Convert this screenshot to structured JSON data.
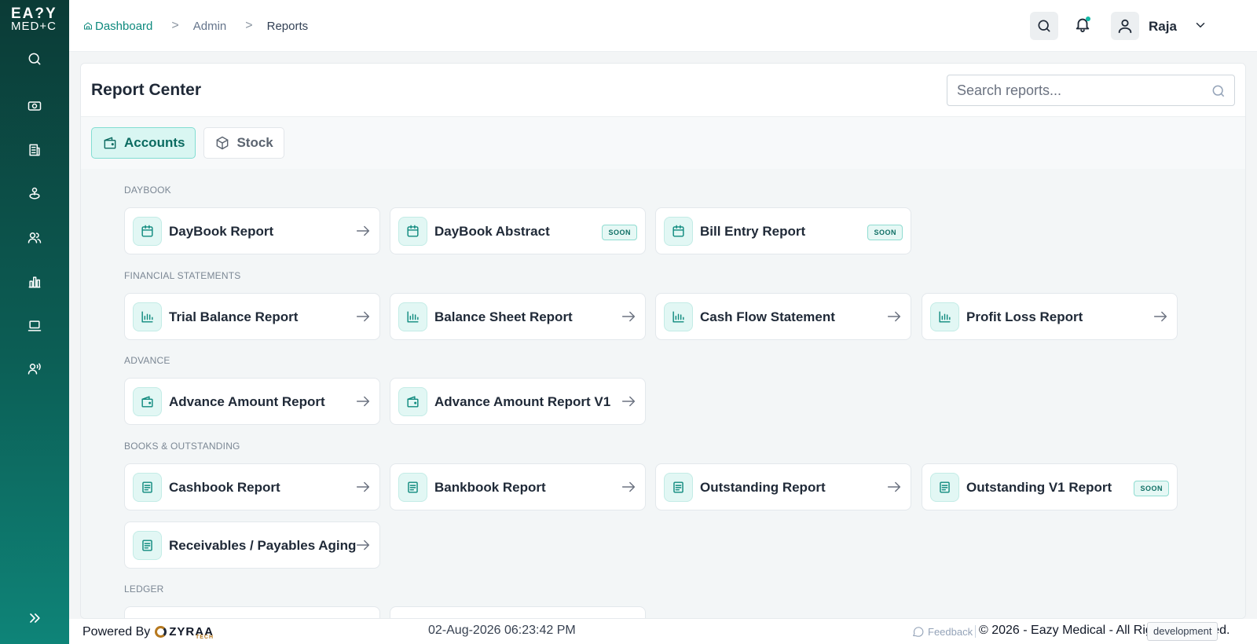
{
  "app": {
    "logo_line1": "EA?Y",
    "logo_line2": "MED+C"
  },
  "breadcrumb": {
    "home": "Dashboard",
    "admin": "Admin",
    "current": "Reports"
  },
  "user": {
    "name": "Raja"
  },
  "page": {
    "title": "Report Center",
    "search_placeholder": "Search reports..."
  },
  "tabs": [
    {
      "label": "Accounts",
      "icon": "wallet-icon",
      "active": true
    },
    {
      "label": "Stock",
      "icon": "box-icon",
      "active": false
    }
  ],
  "sections": {
    "daybook": {
      "label": "DAYBOOK",
      "items": [
        {
          "label": "DayBook Report",
          "soon": false
        },
        {
          "label": "DayBook Abstract",
          "soon": true
        },
        {
          "label": "Bill Entry Report",
          "soon": true
        }
      ]
    },
    "financial": {
      "label": "FINANCIAL STATEMENTS",
      "items": [
        {
          "label": "Trial Balance Report",
          "soon": false
        },
        {
          "label": "Balance Sheet Report",
          "soon": false
        },
        {
          "label": "Cash Flow Statement",
          "soon": false
        },
        {
          "label": "Profit Loss Report",
          "soon": false
        }
      ]
    },
    "advance": {
      "label": "ADVANCE",
      "items": [
        {
          "label": "Advance Amount Report",
          "soon": false
        },
        {
          "label": "Advance Amount Report V1",
          "soon": false
        }
      ]
    },
    "books": {
      "label": "BOOKS & OUTSTANDING",
      "items": [
        {
          "label": "Cashbook Report",
          "soon": false
        },
        {
          "label": "Bankbook Report",
          "soon": false
        },
        {
          "label": "Outstanding Report",
          "soon": false
        },
        {
          "label": "Outstanding V1 Report",
          "soon": true
        },
        {
          "label": "Receivables / Payables Aging",
          "soon": false
        }
      ]
    },
    "ledger": {
      "label": "LEDGER"
    }
  },
  "soon_badge": "SOON",
  "footer": {
    "powered_by": "Powered By",
    "brand": "ZYRAA",
    "brand_sub": "TECH",
    "datetime": "02-Aug-2026 06:23:42 PM",
    "feedback": "Feedback",
    "copyright": "© 2026 - Eazy Medical - All Rights Reserved.",
    "env": "development"
  },
  "colors": {
    "accent": "#0f8a7e",
    "sidebar_top": "#0b3b36",
    "sidebar_bottom": "#0e8478"
  }
}
